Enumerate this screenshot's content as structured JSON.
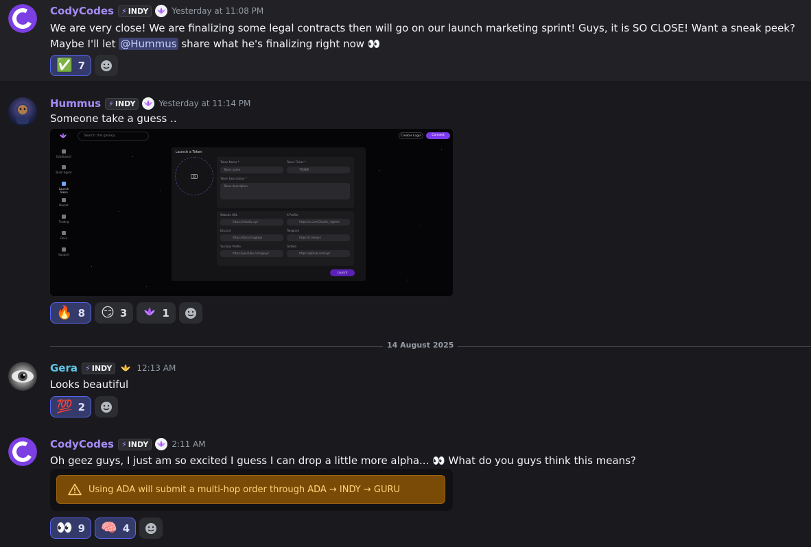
{
  "messages": [
    {
      "username": "CodyCodes",
      "tag": "INDY",
      "timestamp": "Yesterday at 11:08 PM",
      "content_before": "We are very close! We are finalizing some legal contracts then will go on our launch marketing sprint! Guys, it is SO CLOSE! Want a sneak peek? Maybe I'll let ",
      "mention": "@Hummus",
      "content_after": " share what he's finalizing right now 👀",
      "reactions": [
        {
          "emoji": "✅",
          "count": "7",
          "me": true
        }
      ]
    },
    {
      "username": "Hummus",
      "tag": "INDY",
      "timestamp": "Yesterday at 11:14 PM",
      "content": "Someone take a guess ..",
      "reactions": [
        {
          "emoji": "🔥",
          "count": "8",
          "me": true
        },
        {
          "emoji": "😏",
          "count": "3",
          "me": false
        },
        {
          "emoji": "🪷",
          "count": "1",
          "me": false
        }
      ],
      "attachment": {
        "search_placeholder": "Search the galaxy...",
        "creator_login": "Creator Login",
        "connect": "Connect",
        "nav": [
          "Dashboard",
          "Build Agent",
          "Launch Token",
          "Market",
          "Trading",
          "Docs",
          "Support"
        ],
        "panel_title": "Launch a Token",
        "fields": {
          "token_name_label": "Token Name *",
          "token_name_ph": "Token name",
          "token_ticker_label": "Token Ticker *",
          "token_ticker_ph": "TICKER",
          "token_desc_label": "Token Description *",
          "token_desc_ph": "Token description",
          "website_label": "Website URL",
          "website_ph": "https://chaotic.xyz",
          "x_label": "X Profile",
          "x_ph": "https://x.com/Chaotic_Agents",
          "discord_label": "Discord",
          "discord_ph": "https://discord.gg/xyz",
          "telegram_label": "Telegram",
          "telegram_ph": "https://t.me/xyz",
          "youtube_label": "YouTube Profile",
          "youtube_ph": "https://youtube.com/@xyz",
          "github_label": "GitHub",
          "github_ph": "https://github.com/xyz"
        },
        "launch": "Launch"
      }
    },
    {
      "username": "Gera",
      "tag": "INDY",
      "timestamp": "12:13 AM",
      "content": "Looks beautiful",
      "reactions": [
        {
          "emoji": "💯",
          "count": "2",
          "me": true
        }
      ]
    },
    {
      "username": "CodyCodes",
      "tag": "INDY",
      "timestamp": "2:11 AM",
      "content": "Oh geez guys, I just am so excited I guess I can drop a little more alpha... 👀  What do you guys think this means?",
      "warning": "Using ADA will submit a multi-hop order through ADA → INDY → GURU",
      "reactions": [
        {
          "emoji": "👀",
          "count": "9",
          "me": true
        },
        {
          "emoji": "🧠",
          "count": "4",
          "me": true
        }
      ]
    }
  ],
  "date_divider": "14 August 2025",
  "colors": {
    "codycodes": "#a58cf5",
    "hummus": "#a58cf5",
    "gera": "#5ec6e8",
    "mention_bg": "#3c4270",
    "reaction_me_border": "#5865f2",
    "warning_bg": "#7a4b06"
  },
  "icons": {
    "bolt": "⚡",
    "add_reaction": "smiley-icon",
    "warning": "warning-triangle-icon",
    "lotus": "lotus-icon"
  }
}
